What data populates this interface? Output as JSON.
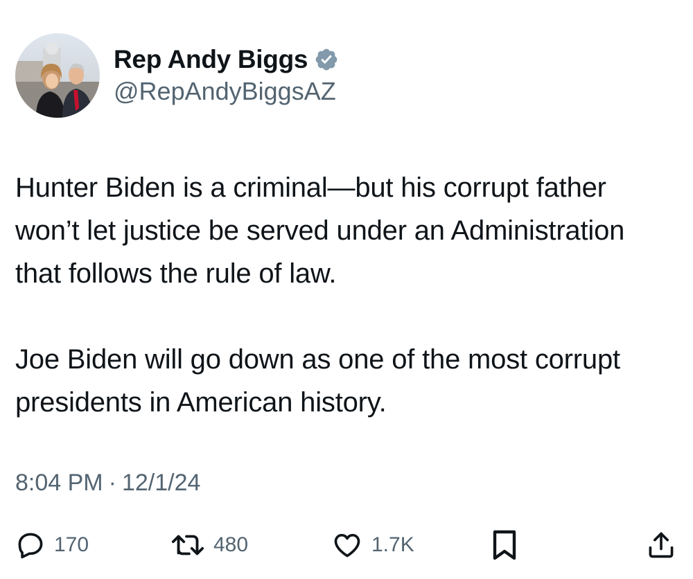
{
  "author": {
    "display_name": "Rep Andy Biggs",
    "handle": "@RepAndyBiggsAZ",
    "verified_icon": "verified-badge-icon",
    "verified_color": "#829aab"
  },
  "tweet": {
    "paragraphs": [
      "Hunter Biden is a criminal—but his corrupt father won’t let justice be served under an Administration that follows the rule of law.",
      "Joe Biden will go down as one of the most corrupt presidents in American history."
    ],
    "time": "8:04 PM",
    "separator": "·",
    "date": "12/1/24"
  },
  "actions": {
    "reply": {
      "icon": "reply-icon",
      "count": "170"
    },
    "retweet": {
      "icon": "retweet-icon",
      "count": "480"
    },
    "like": {
      "icon": "heart-icon",
      "count": "1.7K"
    },
    "bookmark": {
      "icon": "bookmark-icon"
    },
    "share": {
      "icon": "share-icon"
    }
  },
  "colors": {
    "text": "#0f1419",
    "secondary": "#536471",
    "background": "#ffffff"
  }
}
